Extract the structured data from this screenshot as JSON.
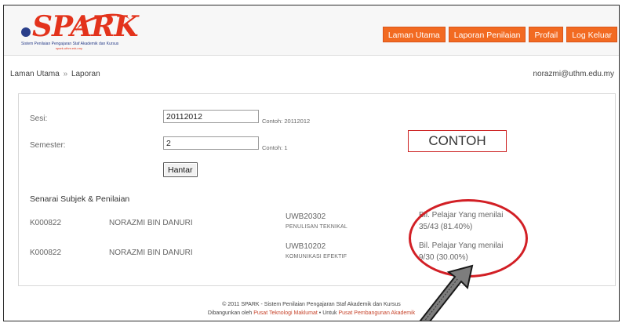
{
  "header": {
    "logo_word": "SPARK",
    "logo_tagline": "Sistem Penilaian Pengajaran Staf Akademik dan Kursus",
    "logo_subtitle": "spark.uthm.edu.my",
    "nav": [
      {
        "label": "Laman Utama"
      },
      {
        "label": "Laporan Penilaian"
      },
      {
        "label": "Profail"
      },
      {
        "label": "Log Keluar"
      }
    ]
  },
  "breadcrumb": {
    "home": "Laman Utama",
    "separator": "»",
    "current": "Laporan"
  },
  "user": {
    "email": "norazmi@uthm.edu.my"
  },
  "form": {
    "sesi_label": "Sesi:",
    "sesi_value": "20112012",
    "sesi_hint": "Contoh: 20112012",
    "semester_label": "Semester:",
    "semester_value": "2",
    "semester_hint": "Contoh: 1",
    "submit_label": "Hantar"
  },
  "annotation": {
    "contoh_label": "CONTOH",
    "highlight_color": "#d21f25"
  },
  "list": {
    "title": "Senarai Subjek & Penilaian",
    "rows": [
      {
        "staff_id": "K000822",
        "name": "NORAZMI BIN DANURI",
        "code": "UWB20302",
        "subject": "PENULISAN TEKNIKAL",
        "eval_label": "Bil. Pelajar Yang menilai",
        "eval_value": "35/43  (81.40%)"
      },
      {
        "staff_id": "K000822",
        "name": "NORAZMI BIN DANURI",
        "code": "UWB10202",
        "subject": "KOMUNIKASI EFEKTIF",
        "eval_label": "Bil. Pelajar Yang menilai",
        "eval_value": "9/30  (30.00%)"
      }
    ]
  },
  "footer": {
    "line1": "© 2011 SPARK - Sistem Penilaian Pengajaran Staf Akademik dan Kursus",
    "line2_prefix": "Dibangunkan oleh",
    "line2_link1": "Pusat Teknologi Maklumat",
    "line2_sep": "•",
    "line2_mid": "Untuk",
    "line2_link2": "Pusat Pembangunan Akademik"
  },
  "colors": {
    "nav_bg": "#f26a21",
    "logo_red": "#e3331c",
    "logo_blue": "#2a3f8a"
  }
}
